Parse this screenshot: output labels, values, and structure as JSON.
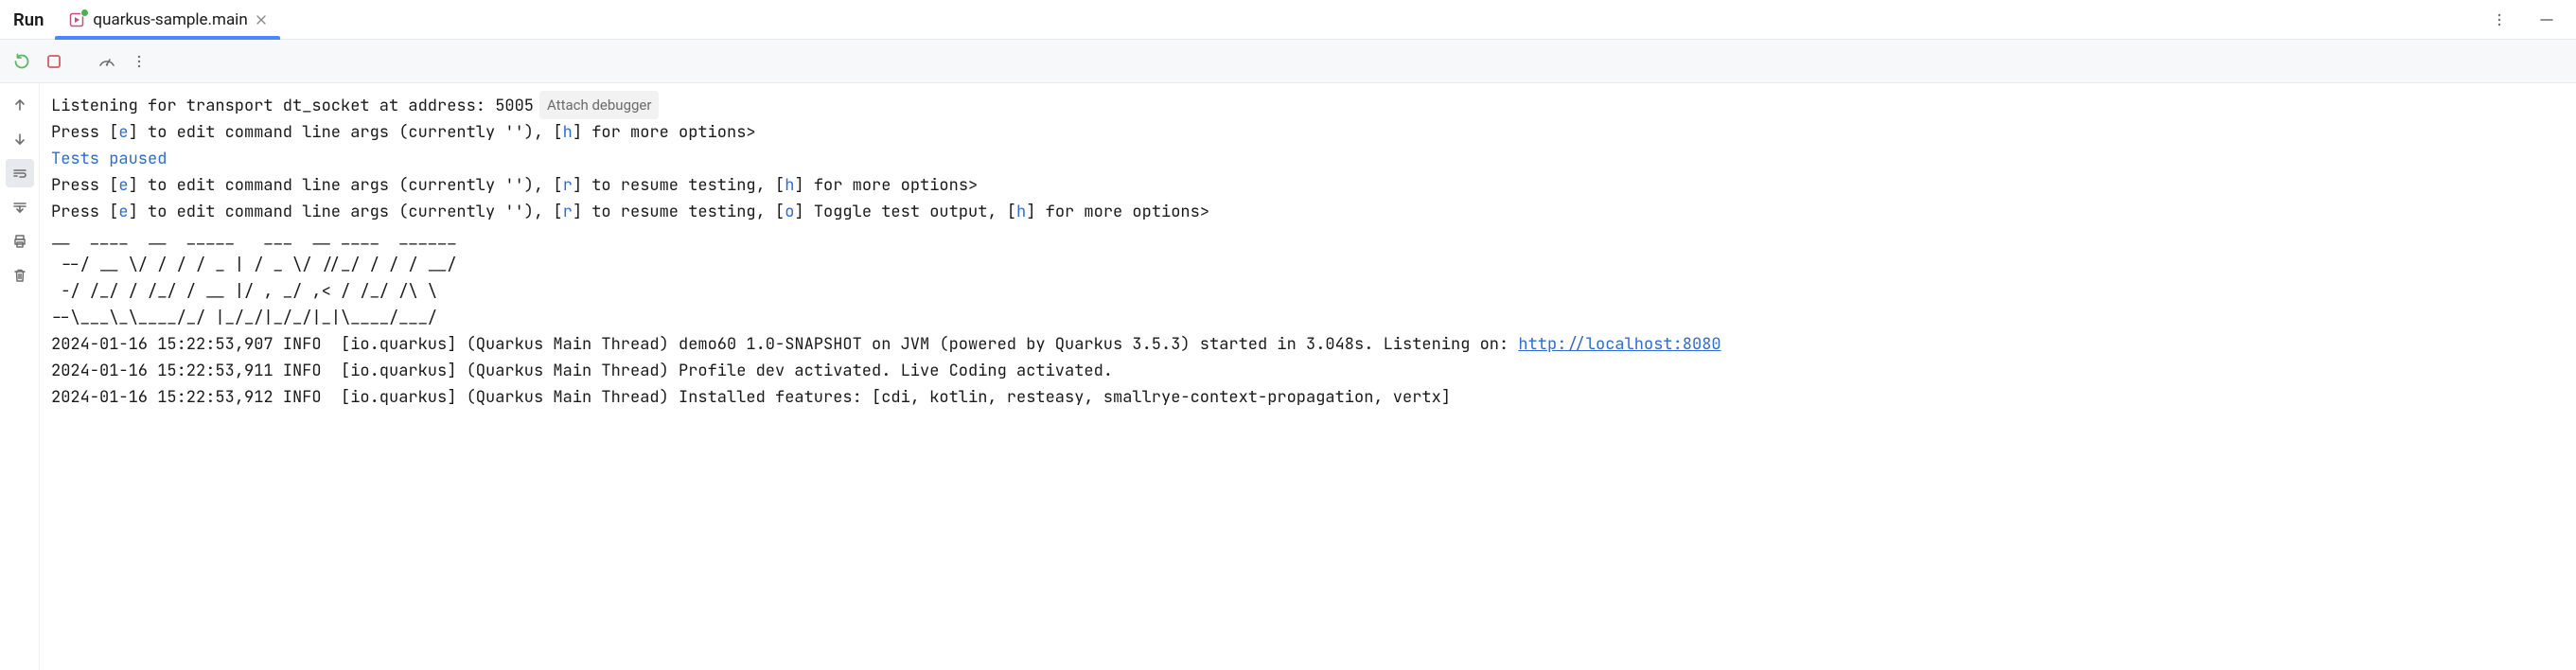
{
  "header": {
    "title": "Run",
    "tab": {
      "label": "quarkus-sample.main"
    }
  },
  "console": {
    "line1_prefix": "Listening for transport dt_socket at address: 5005",
    "attach_hint": "Attach debugger",
    "press_line_a_p1": "Press [",
    "key_e": "e",
    "press_line_a_p2": "] to edit command line args (currently ''), [",
    "key_h": "h",
    "press_line_a_p3": "] for more options>",
    "tests_paused": "Tests paused",
    "press_line_b_p1": "Press [",
    "press_line_b_p2": "] to edit command line args (currently ''), [",
    "key_r": "r",
    "press_line_b_p3": "] to resume testing, [",
    "press_line_b_p4": "] for more options>",
    "press_line_c_p1": "Press [",
    "press_line_c_p2": "] to edit command line args (currently ''), [",
    "press_line_c_p3": "] to resume testing, [",
    "key_o": "o",
    "press_line_c_p4": "] Toggle test output, [",
    "press_line_c_p5": "] for more options>",
    "banner1": "__  ____  __  _____   ___  __ ____  ______ ",
    "banner2": " --/ __ \\/ / / / _ | / _ \\/ //_/ / / / __/ ",
    "banner3": " -/ /_/ / /_/ / __ |/ , _/ ,< / /_/ /\\ \\   ",
    "banner4": "--\\___\\_\\____/_/ |_/_/|_/_/|_|\\____/___/   ",
    "log1_pre": "2024-01-16 15:22:53,907 INFO  [io.quarkus] (Quarkus Main Thread) demo60 1.0-SNAPSHOT on JVM (powered by Quarkus 3.5.3) started in 3.048s. Listening on: ",
    "log1_link": "http://localhost:8080",
    "log2": "2024-01-16 15:22:53,911 INFO  [io.quarkus] (Quarkus Main Thread) Profile dev activated. Live Coding activated.",
    "log3": "2024-01-16 15:22:53,912 INFO  [io.quarkus] (Quarkus Main Thread) Installed features: [cdi, kotlin, resteasy, smallrye-context-propagation, vertx]"
  }
}
